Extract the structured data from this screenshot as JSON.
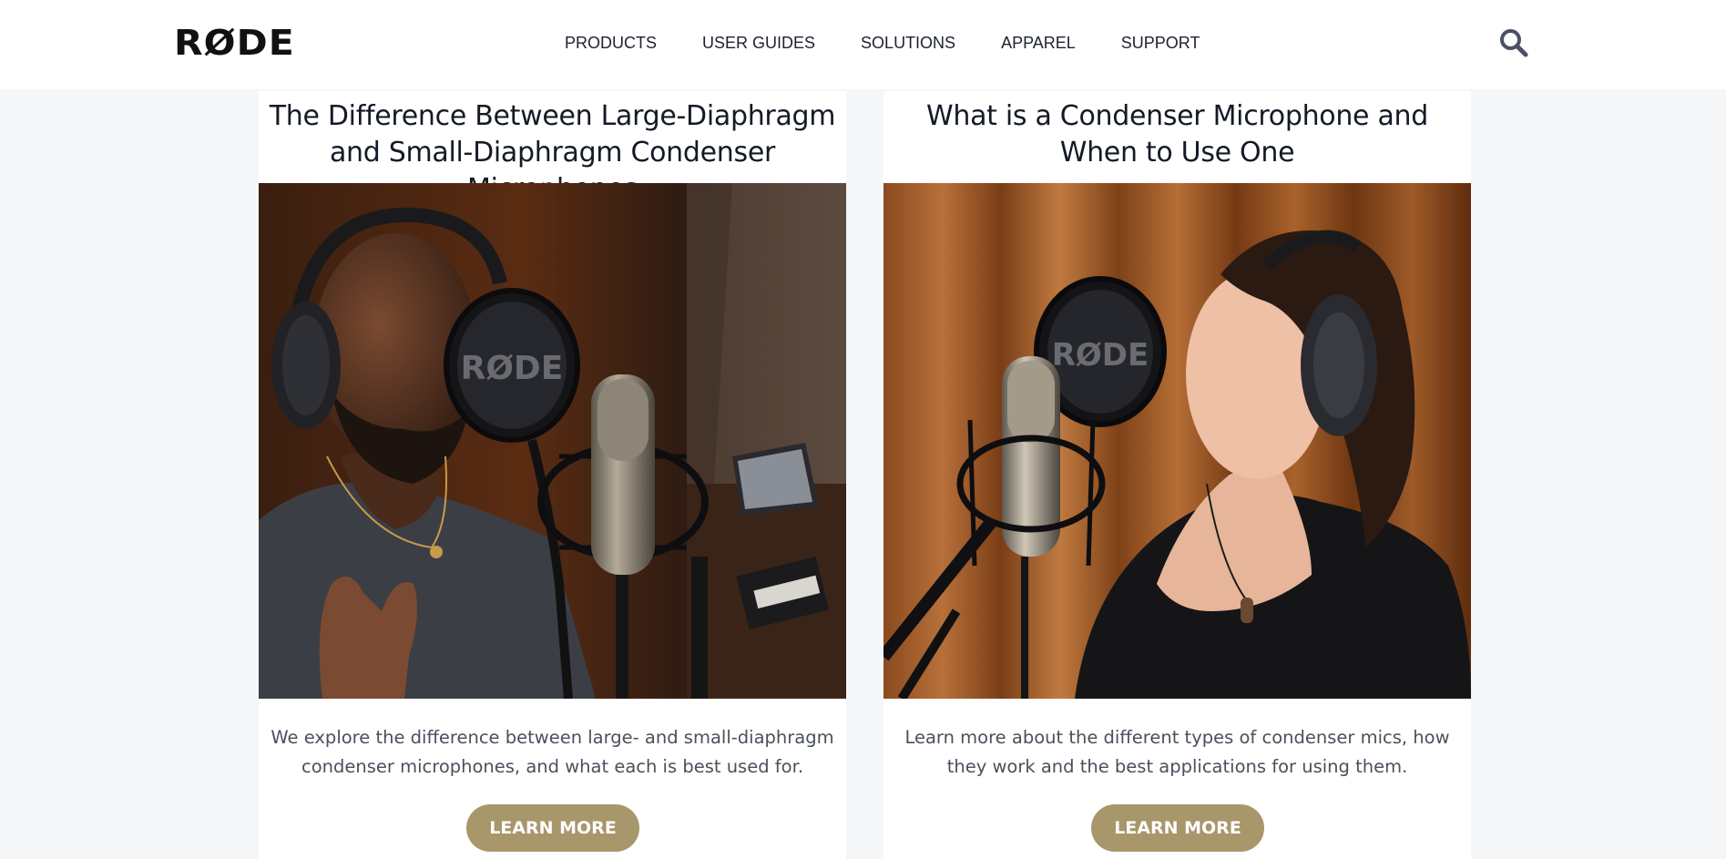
{
  "header": {
    "logo_text": "RØDE",
    "nav": [
      {
        "label": "PRODUCTS"
      },
      {
        "label": "USER GUIDES"
      },
      {
        "label": "SOLUTIONS"
      },
      {
        "label": "APPAREL"
      },
      {
        "label": "SUPPORT"
      }
    ],
    "search_icon": "search-icon"
  },
  "cards": [
    {
      "title": "The Difference Between Large-Diaphragm and Small-Diaphragm Condenser Microphones",
      "image_alt": "Man singing into a condenser microphone with pop filter",
      "pop_filter_text": "RØDE",
      "description": "We explore the difference between large- and small-diaphragm condenser microphones, and what each is best used for.",
      "button": "LEARN MORE"
    },
    {
      "title": "What is a Condenser Microphone and When to Use One",
      "image_alt": "Woman singing into a condenser microphone in a studio",
      "pop_filter_text": "RØDE",
      "description": "Learn more about the different types of condenser mics, how they work and the best applications for using them.",
      "button": "LEARN MORE"
    }
  ],
  "colors": {
    "accent": "#a8976b",
    "background": "#f4f6f8",
    "text": "#141a26"
  }
}
